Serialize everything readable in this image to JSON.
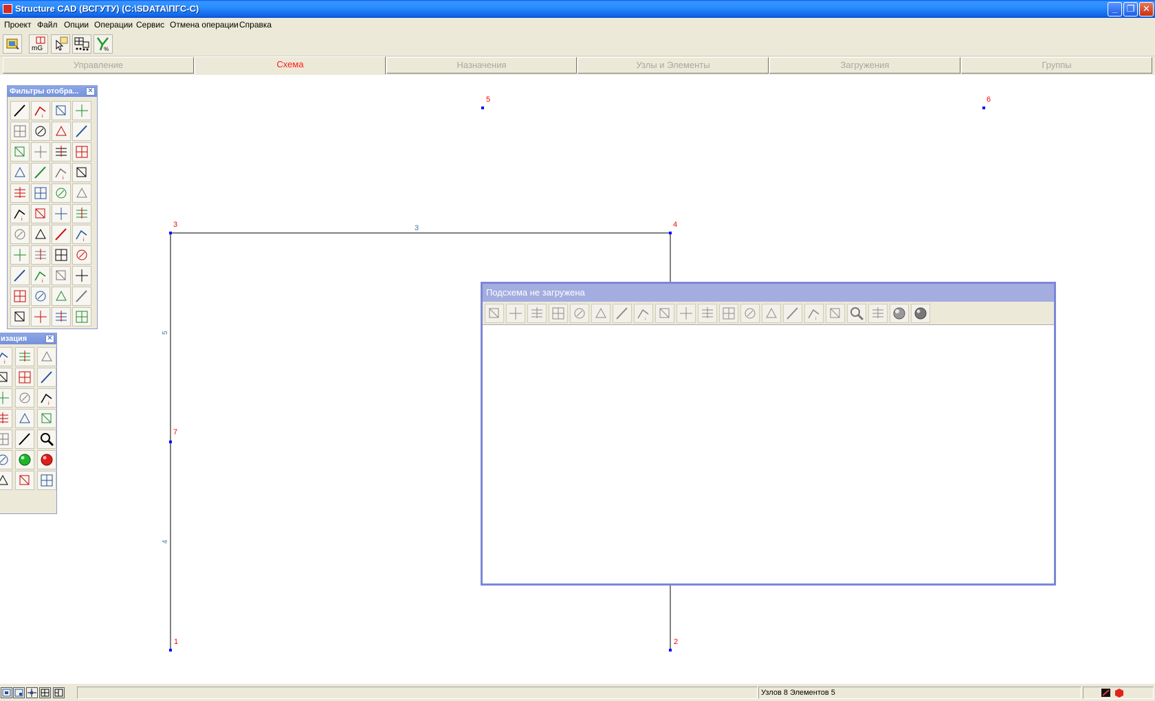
{
  "window": {
    "title": "Structure CAD (ВСГУТУ) (C:\\SDATA\\ПГС-С)",
    "minimize": "_",
    "maximize": "❐",
    "close": "✕"
  },
  "menu": [
    "Проект",
    "Файл",
    "Опции",
    "Операции",
    "Сервис",
    "Отмена операции",
    "Справка"
  ],
  "toolbar": {
    "mg_label": "mG"
  },
  "tabs": [
    {
      "label": "Управление",
      "active": false
    },
    {
      "label": "Схема",
      "active": true
    },
    {
      "label": "Назначения",
      "active": false
    },
    {
      "label": "Узлы и Элементы",
      "active": false
    },
    {
      "label": "Загружения",
      "active": false
    },
    {
      "label": "Группы",
      "active": false
    }
  ],
  "filters_palette": {
    "title": "Фильтры отобра...",
    "close": "✕"
  },
  "vis_palette": {
    "title": "изация",
    "close": "✕"
  },
  "scheme": {
    "nodes": [
      {
        "label": "1"
      },
      {
        "label": "2"
      },
      {
        "label": "3"
      },
      {
        "label": "4"
      },
      {
        "label": "5"
      },
      {
        "label": "6"
      },
      {
        "label": "7"
      }
    ],
    "elements": [
      {
        "label": "3"
      },
      {
        "label": "5"
      },
      {
        "label": "4"
      }
    ],
    "node_color": "#ff0000",
    "element_label_color": "#2f7fa0"
  },
  "subwindow": {
    "title": "Подсхема не загружена"
  },
  "status": {
    "info": "Узлов 8 Элементов 5"
  },
  "colors": {
    "titlebar": "#0a5ae8",
    "window_bg": "#ece9d8",
    "active_tab": "#ff1a1a",
    "node_marker": "#0000ff"
  }
}
